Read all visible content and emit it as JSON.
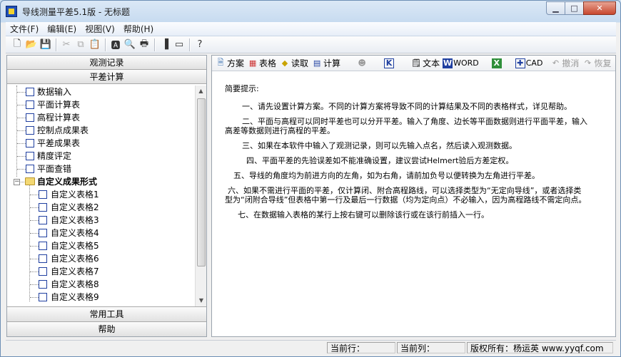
{
  "window": {
    "title": "导线测量平差5.1版 - 无标题"
  },
  "menu": [
    "文件(F)",
    "编辑(E)",
    "视图(V)",
    "帮助(H)"
  ],
  "left_panel": {
    "header_top": "观测记录",
    "header_second": "平差计算",
    "tree_items": [
      "数据输入",
      "平面计算表",
      "高程计算表",
      "控制点成果表",
      "平差成果表",
      "精度评定",
      "平面查错"
    ],
    "folder": "自定义成果形式",
    "custom_tables": [
      "自定义表格1",
      "自定义表格2",
      "自定义表格3",
      "自定义表格4",
      "自定义表格5",
      "自定义表格6",
      "自定义表格7",
      "自定义表格8",
      "自定义表格9"
    ],
    "footer_tools": "常用工具",
    "footer_help": "帮助"
  },
  "right_toolbar": {
    "scheme": "方案",
    "table": "表格",
    "read": "读取",
    "calc": "计算",
    "text": "文本",
    "word": "WORD",
    "cad": "CAD",
    "undo": "撤消",
    "redo": "恢复"
  },
  "hints": {
    "title": "简要提示:",
    "p1": "一、请先设置计算方案。不同的计算方案将导致不同的计算结果及不同的表格样式，详见帮助。",
    "p2": "二、平面与高程可以同时平差也可以分开平差。输入了角度、边长等平面数据则进行平面平差，输入高差等数据则进行高程的平差。",
    "p3": "三、如果在本软件中输入了观测记录，则可以先输入点名，然后读入观测数据。",
    "p4": "四、平面平差的先验误差如不能准确设置，建议尝试Helmert验后方差定权。",
    "p5": "五、导线的角度均为前进方向的左角，如为右角，请前加负号以便转换为左角进行平差。",
    "p6": "六、如果不需进行平面的平差，仅计算闭、附合高程路线，可以选择类型为“无定向导线”，或者选择类型为“闭附合导线”但表格中第一行及最后一行数据（均为定向点）不必输入，因为高程路线不需定向点。",
    "p7": "七、在数据输入表格的某行上按右键可以删除该行或在该行前插入一行。"
  },
  "status": {
    "row": "当前行：",
    "col": "当前列：",
    "copyright": "版权所有：杨运英 www.yyqf.com"
  }
}
